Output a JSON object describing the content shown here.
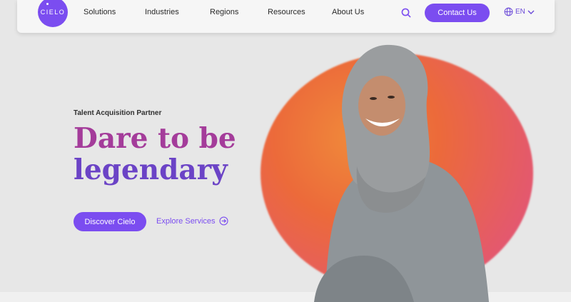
{
  "nav": {
    "logo_text": "CIELO",
    "items": [
      {
        "label": "Solutions"
      },
      {
        "label": "Industries"
      },
      {
        "label": "Regions"
      },
      {
        "label": "Resources"
      },
      {
        "label": "About Us"
      }
    ],
    "contact_label": "Contact Us",
    "language": "EN"
  },
  "hero": {
    "eyebrow": "Talent Acquisition Partner",
    "headline_line1": "Dare to be",
    "headline_line2": "legendary",
    "primary_cta": "Discover Cielo",
    "secondary_cta": "Explore Services"
  },
  "colors": {
    "accent": "#7b4df0",
    "headline_magenta": "#a43c9a",
    "headline_purple": "#6b43c6"
  }
}
